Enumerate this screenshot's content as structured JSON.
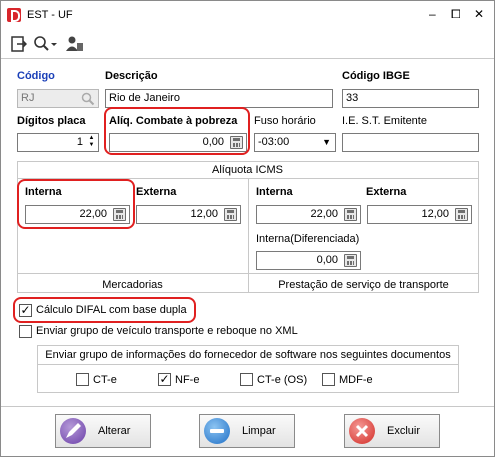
{
  "window": {
    "title": "EST - UF",
    "min": "–",
    "max": "⧠",
    "close": "✕"
  },
  "fields": {
    "codigo": {
      "label": "Código",
      "value": "RJ"
    },
    "descricao": {
      "label": "Descrição",
      "value": "Rio de Janeiro"
    },
    "codigo_ibge": {
      "label": "Código IBGE",
      "value": "33"
    },
    "digitos_placa": {
      "label": "Dígitos placa",
      "value": "1"
    },
    "aliq_pobreza": {
      "label": "Alíq. Combate à pobreza",
      "value": "0,00"
    },
    "fuso": {
      "label": "Fuso horário",
      "value": "-03:00"
    },
    "ie_st": {
      "label": "I.E. S.T.  Emitente",
      "value": ""
    }
  },
  "aliquota_icms": {
    "title": "Alíquota ICMS",
    "mercadorias": {
      "label": "Mercadorias",
      "interna_label": "Interna",
      "interna_value": "22,00",
      "externa_label": "Externa",
      "externa_value": "12,00"
    },
    "transporte": {
      "label": "Prestação de serviço de transporte",
      "interna_label": "Interna",
      "interna_value": "22,00",
      "externa_label": "Externa",
      "externa_value": "12,00",
      "diferenciada_label": "Interna(Diferenciada)",
      "diferenciada_value": "0,00"
    }
  },
  "options": {
    "difal": {
      "label": "Cálculo DIFAL com base dupla",
      "checked": true
    },
    "reboque": {
      "label": "Enviar grupo de veículo transporte e reboque no XML",
      "checked": false
    }
  },
  "fornecedor": {
    "title": "Enviar grupo de informações do fornecedor de software nos seguintes documentos",
    "items": [
      {
        "label": "CT-e",
        "checked": false
      },
      {
        "label": "NF-e",
        "checked": true
      },
      {
        "label": "CT-e (OS)",
        "checked": false
      },
      {
        "label": "MDF-e",
        "checked": false
      }
    ]
  },
  "buttons": {
    "alterar": "Alterar",
    "limpar": "Limpar",
    "excluir": "Excluir"
  },
  "colors": {
    "label_blue": "#1a3fb8",
    "highlight": "#e02020"
  }
}
